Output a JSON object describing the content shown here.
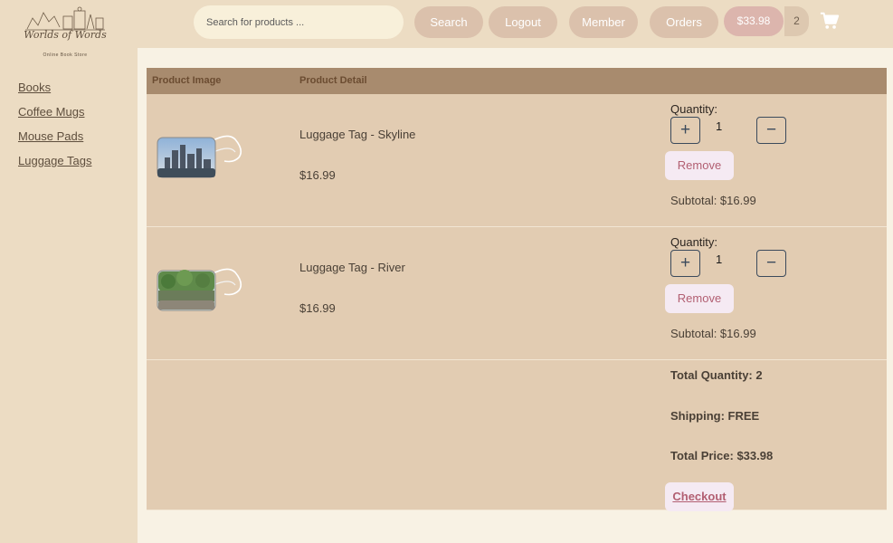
{
  "brand": {
    "logo_title": "Worlds of Words",
    "logo_subtitle": "Online Book Store"
  },
  "sidebar": {
    "items": [
      {
        "label": "Books"
      },
      {
        "label": "Coffee Mugs"
      },
      {
        "label": "Mouse Pads"
      },
      {
        "label": "Luggage Tags"
      }
    ]
  },
  "header": {
    "search_placeholder": "Search for products ...",
    "search_label": "Search",
    "logout_label": "Logout",
    "member_label": "Member",
    "orders_label": "Orders",
    "cart_total": "$33.98",
    "cart_count": "2",
    "cart_icon": "shopping-cart-icon"
  },
  "table": {
    "col_image": "Product Image",
    "col_detail": "Product Detail",
    "items": [
      {
        "name": "Luggage Tag - Skyline",
        "price": "$16.99",
        "quantity_label": "Quantity:",
        "quantity": "1",
        "plus": "+",
        "minus": "−",
        "remove_label": "Remove",
        "subtotal": "Subtotal: $16.99"
      },
      {
        "name": "Luggage Tag - River",
        "price": "$16.99",
        "quantity_label": "Quantity:",
        "quantity": "1",
        "plus": "+",
        "minus": "−",
        "remove_label": "Remove",
        "subtotal": "Subtotal: $16.99"
      }
    ]
  },
  "totals": {
    "total_quantity": "Total Quantity: 2",
    "shipping": "Shipping: FREE",
    "total_price": "Total Price: $33.98",
    "checkout_label": "Checkout"
  },
  "colors": {
    "sidebar_bg": "#ecdcc3",
    "table_header": "#a88b6e",
    "row_bg": "#e2ccb2",
    "button_pill": "#dbc1ac",
    "cart_total": "#dcb5ad",
    "remove_text": "#b25f72"
  }
}
